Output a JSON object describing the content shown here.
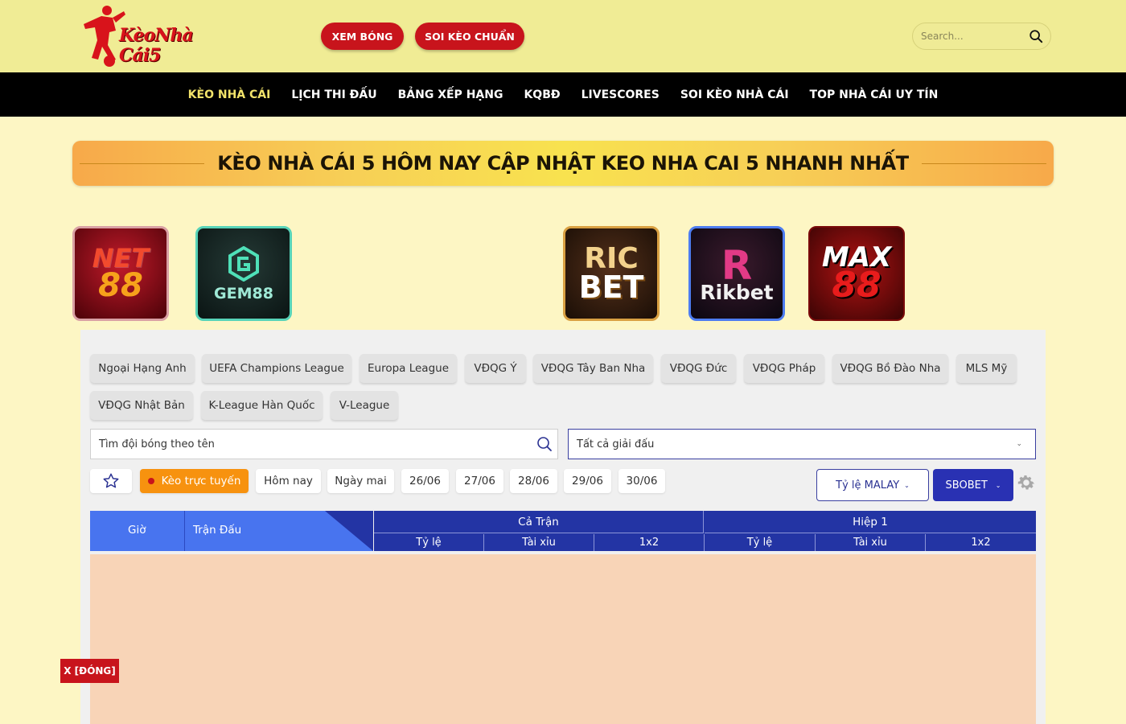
{
  "header": {
    "logo": {
      "line1": "KèoNhà",
      "line2": "Cái5"
    },
    "buttons": [
      "XEM BÓNG",
      "SOI KÈO CHUẨN"
    ],
    "search_placeholder": "Search..."
  },
  "nav": {
    "items": [
      "KÈO NHÀ CÁI",
      "LỊCH THI ĐẤU",
      "BẢNG XẾP HẠNG",
      "KQBĐ",
      "LIVESCORES",
      "SOI KÈO NHÀ CÁI",
      "TOP NHÀ CÁI UY TÍN"
    ],
    "active_index": 0
  },
  "banner": {
    "title": "KÈO NHÀ CÁI 5 HÔM NAY CẬP NHẬT KEO NHA CAI 5 NHANH NHẤT"
  },
  "brands": [
    {
      "id": "net88",
      "line1": "NET",
      "line2": "88"
    },
    {
      "id": "gem88",
      "line1": "GEM88"
    },
    {
      "id": "ricbet",
      "line1": "RIC",
      "line2": "BET"
    },
    {
      "id": "rikbet",
      "line1": "R",
      "line2": "Rikbet"
    },
    {
      "id": "max88",
      "line1": "MAX",
      "line2": "88"
    }
  ],
  "leagues": [
    "Ngoại Hạng Anh",
    "UEFA Champions League",
    "Europa League",
    "VĐQG Ý",
    "VĐQG Tây Ban Nha",
    "VĐQG Đức",
    "VĐQG Pháp",
    "VĐQG Bồ Đào Nha",
    "MLS Mỹ",
    "VĐQG Nhật Bản",
    "K-League Hàn Quốc",
    "V-League"
  ],
  "filters": {
    "team_search_placeholder": "Tìm đội bóng theo tên",
    "league_select_value": "Tất cả giải đấu",
    "live_label": "Kèo trực tuyến",
    "dates": [
      "Hôm nay",
      "Ngày mai",
      "26/06",
      "27/06",
      "28/06",
      "29/06",
      "30/06"
    ],
    "ratio_label": "Tỷ lệ MALAY",
    "bookmaker_label": "SBOBET"
  },
  "table": {
    "col_time": "Giờ",
    "col_match": "Trận Đấu",
    "group_full": "Cả Trận",
    "group_half": "Hiệp 1",
    "sub_cols": [
      "Tỷ lệ",
      "Tài xỉu",
      "1x2",
      "Tỷ lệ",
      "Tài xỉu",
      "1x2"
    ]
  },
  "close_label": "X [ĐÓNG]",
  "colors": {
    "brand_red": "#c8141c",
    "nav_active": "#f2e36a",
    "table_dark": "#2334a4",
    "table_light": "#4874ef",
    "live_orange": "#f7920f"
  }
}
